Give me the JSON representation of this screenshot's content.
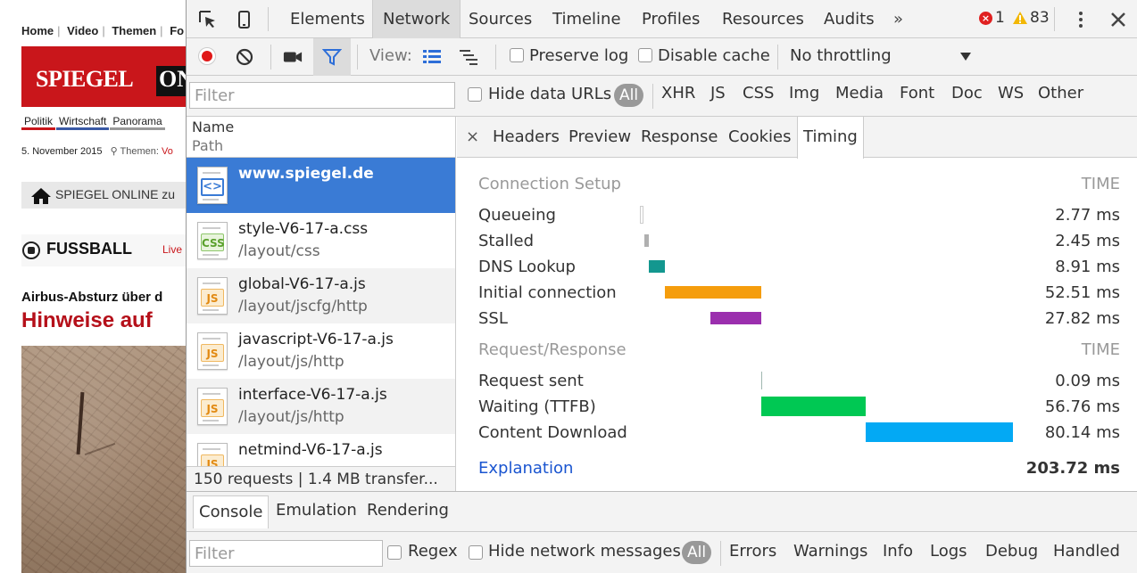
{
  "page": {
    "nav": [
      "Home",
      "Video",
      "Themen",
      "Fo"
    ],
    "logo_text": "SPIEGEL",
    "logo_onl": "ONL",
    "categories": [
      "Politik",
      "Wirtschaft",
      "Panorama"
    ],
    "date": "5. November 2015",
    "themes_label": "Themen:",
    "themes_value": "Vo",
    "homebar_label": "SPIEGEL ONLINE zu",
    "fussball": "FUSSBALL",
    "live": "Live",
    "headline_small": "Airbus-Absturz über d",
    "headline_big": "Hinweise auf"
  },
  "devtools": {
    "tabs": [
      "Elements",
      "Network",
      "Sources",
      "Timeline",
      "Profiles",
      "Resources",
      "Audits"
    ],
    "more": "»",
    "error_count": "1",
    "warning_count": "83",
    "toolbar": {
      "view_label": "View:",
      "preserve_log": "Preserve log",
      "disable_cache": "Disable cache",
      "throttling": "No throttling"
    },
    "filter": {
      "placeholder": "Filter",
      "hide_data_urls": "Hide data URLs",
      "all": "All",
      "types": [
        "XHR",
        "JS",
        "CSS",
        "Img",
        "Media",
        "Font",
        "Doc",
        "WS",
        "Other"
      ]
    },
    "requests": {
      "header_name": "Name",
      "header_path": "Path",
      "rows": [
        {
          "name": "www.spiegel.de",
          "path": "",
          "type": "<>"
        },
        {
          "name": "style-V6-17-a.css",
          "path": "/layout/css",
          "type": "CSS"
        },
        {
          "name": "global-V6-17-a.js",
          "path": "/layout/jscfg/http",
          "type": "JS"
        },
        {
          "name": "javascript-V6-17-a.js",
          "path": "/layout/js/http",
          "type": "JS"
        },
        {
          "name": "interface-V6-17-a.js",
          "path": "/layout/js/http",
          "type": "JS"
        },
        {
          "name": "netmind-V6-17-a.js",
          "path": "",
          "type": "JS"
        }
      ],
      "footer": "150 requests | 1.4 MB transfer..."
    },
    "detail": {
      "close": "×",
      "tabs": [
        "Headers",
        "Preview",
        "Response",
        "Cookies",
        "Timing"
      ],
      "active_tab": "Timing",
      "connection_setup": "Connection Setup",
      "request_response": "Request/Response",
      "time_header": "TIME",
      "connection_rows": [
        {
          "label": "Queueing",
          "value": "2.77 ms",
          "color": "#ffffff"
        },
        {
          "label": "Stalled",
          "value": "2.45 ms",
          "color": "#b0b0b0"
        },
        {
          "label": "DNS Lookup",
          "value": "8.91 ms",
          "color": "#13978f"
        },
        {
          "label": "Initial connection",
          "value": "52.51 ms",
          "color": "#f59d0d"
        },
        {
          "label": "SSL",
          "value": "27.82 ms",
          "color": "#9b2fae"
        }
      ],
      "request_rows": [
        {
          "label": "Request sent",
          "value": "0.09 ms",
          "color": "#a0b8b0"
        },
        {
          "label": "Waiting (TTFB)",
          "value": "56.76 ms",
          "color": "#00c853"
        },
        {
          "label": "Content Download",
          "value": "80.14 ms",
          "color": "#03a9f4"
        }
      ],
      "explanation": "Explanation",
      "total": "203.72 ms"
    },
    "drawer": {
      "tabs": [
        "Console",
        "Emulation",
        "Rendering"
      ],
      "filter_placeholder": "Filter",
      "regex": "Regex",
      "hide_network": "Hide network messages",
      "all": "All",
      "levels": [
        "Errors",
        "Warnings",
        "Info",
        "Logs",
        "Debug",
        "Handled"
      ]
    }
  }
}
